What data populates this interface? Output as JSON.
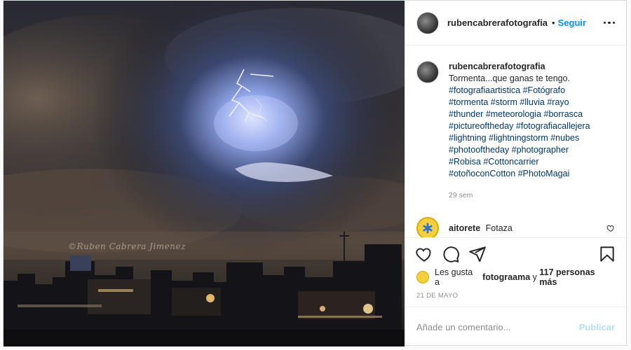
{
  "header": {
    "username": "rubencabrerafotografia",
    "separator": "•",
    "follow_label": "Seguir"
  },
  "photo": {
    "watermark": "©Ruben Cabrera Jimenez",
    "description_icon": "night-city-lightning-photo"
  },
  "caption": {
    "username": "rubencabrerafotografia",
    "text": "Tormenta...que ganas te tengo.",
    "hashtag_lines": [
      "#fotografiaartistica #Fotógrafo",
      "#tormenta #storm #lluvia #rayo",
      "#thunder #meteorologia #borrasca",
      "#pictureoftheday #fotografiacallejera",
      "#lightning #lightningstorm #nubes",
      "#photooftheday #photographer",
      "#Robisa #Cottoncarrier",
      "#otoñoconCotton #PhotoMagai"
    ],
    "time_ago": "29 sem"
  },
  "comments": [
    {
      "username": "aitorete",
      "text": "Fotaza"
    }
  ],
  "actions": {
    "like_icon": "heart-icon",
    "comment_icon": "comment-icon",
    "share_icon": "share-icon",
    "save_icon": "bookmark-icon"
  },
  "likes": {
    "prefix": "Les gusta a",
    "user": "fotograama",
    "connector": "y",
    "others": "117 personas más"
  },
  "date": "21 DE MAYO",
  "add_comment": {
    "placeholder": "Añade un comentario...",
    "publish_label": "Publicar"
  },
  "colors": {
    "accent": "#0095f6",
    "publish_disabled": "#b2dffc",
    "hashtag": "#00376b",
    "muted": "#8e8e8e"
  }
}
